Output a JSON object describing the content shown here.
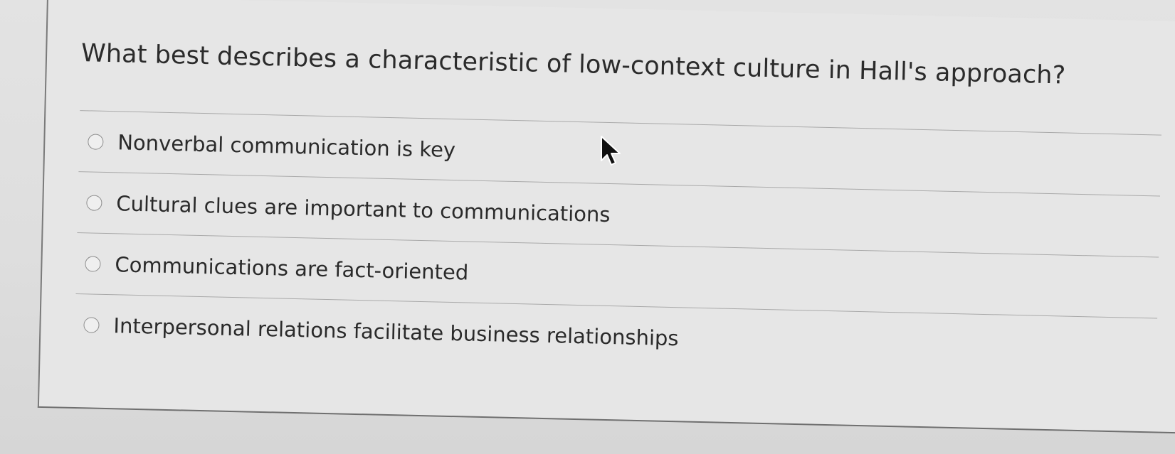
{
  "question": {
    "text": "What best describes a characteristic of low-context culture in Hall's approach?"
  },
  "options": [
    {
      "label": "Nonverbal communication is key",
      "selected": false
    },
    {
      "label": "Cultural clues are important to communications",
      "selected": false
    },
    {
      "label": "Communications are fact-oriented",
      "selected": false
    },
    {
      "label": "Interpersonal relations facilitate business relationships",
      "selected": false
    }
  ],
  "icons": {
    "pointer": "mouse-pointer-icon"
  },
  "colors": {
    "background": "#e3e3e3",
    "text": "#2b2b2b",
    "divider": "#a9a9a9"
  }
}
